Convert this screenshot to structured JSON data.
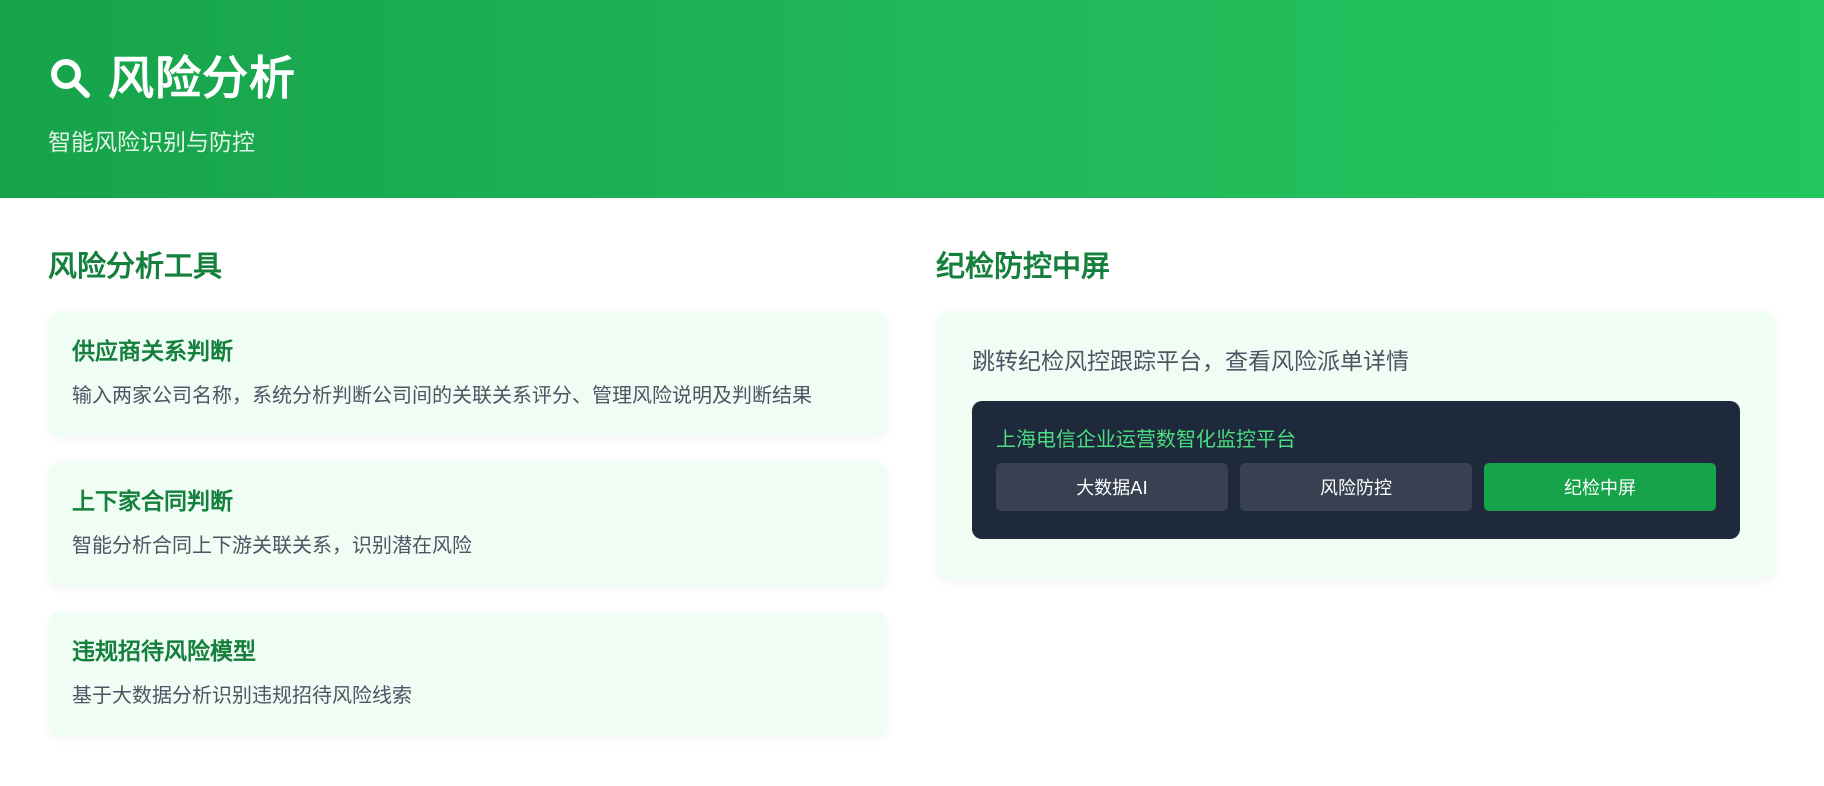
{
  "header": {
    "icon": "search-icon",
    "title": "风险分析",
    "subtitle": "智能风险识别与防控"
  },
  "tools": {
    "title": "风险分析工具",
    "cards": [
      {
        "title": "供应商关系判断",
        "description": "输入两家公司名称，系统分析判断公司间的关联关系评分、管理风险说明及判断结果"
      },
      {
        "title": "上下家合同判断",
        "description": "智能分析合同上下游关联关系，识别潜在风险"
      },
      {
        "title": "违规招待风险模型",
        "description": "基于大数据分析识别违规招待风险线索"
      }
    ]
  },
  "screen": {
    "title": "纪检防控中屏",
    "description": "跳转纪检风控跟踪平台，查看风险派单详情",
    "platform": {
      "title": "上海电信企业运营数智化监控平台",
      "tabs": [
        {
          "label": "大数据AI",
          "active": false
        },
        {
          "label": "风险防控",
          "active": false
        },
        {
          "label": "纪检中屏",
          "active": true
        }
      ]
    }
  },
  "colors": {
    "header_start": "#16a34a",
    "header_end": "#22c55e",
    "accent_text": "#15803d",
    "card_bg": "#f0fdf4",
    "panel_bg": "#1e293b",
    "panel_title": "#4ade80",
    "tab_bg": "#374151",
    "tab_active_bg": "#16a34a"
  }
}
